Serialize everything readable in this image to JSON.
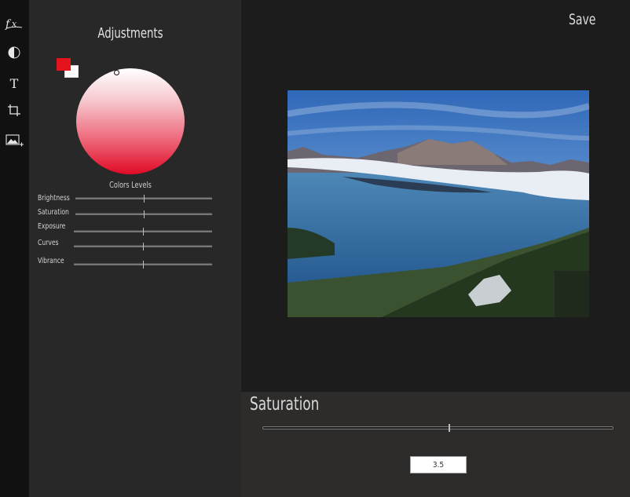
{
  "toolbar": {
    "tools": [
      "fx-icon",
      "contrast-icon",
      "text-icon",
      "crop-icon",
      "add-image-icon"
    ],
    "text_tool_glyph": "T"
  },
  "panel": {
    "title": "Adjustments",
    "colors": {
      "foreground": "#e3141c",
      "background": "#ffffff"
    },
    "colors_label": "Colors Levels",
    "adjustments": [
      {
        "label": "Brightness",
        "value": 0.5
      },
      {
        "label": "Saturation",
        "value": 0.5
      },
      {
        "label": "Exposure",
        "value": 0.5
      },
      {
        "label": "Curves",
        "value": 0.5
      },
      {
        "label": "Vibrance",
        "value": 0.5
      }
    ]
  },
  "header": {
    "save_label": "Save"
  },
  "bottom": {
    "title": "Saturation",
    "slider_value": 0.53,
    "value_display": "3.5"
  }
}
